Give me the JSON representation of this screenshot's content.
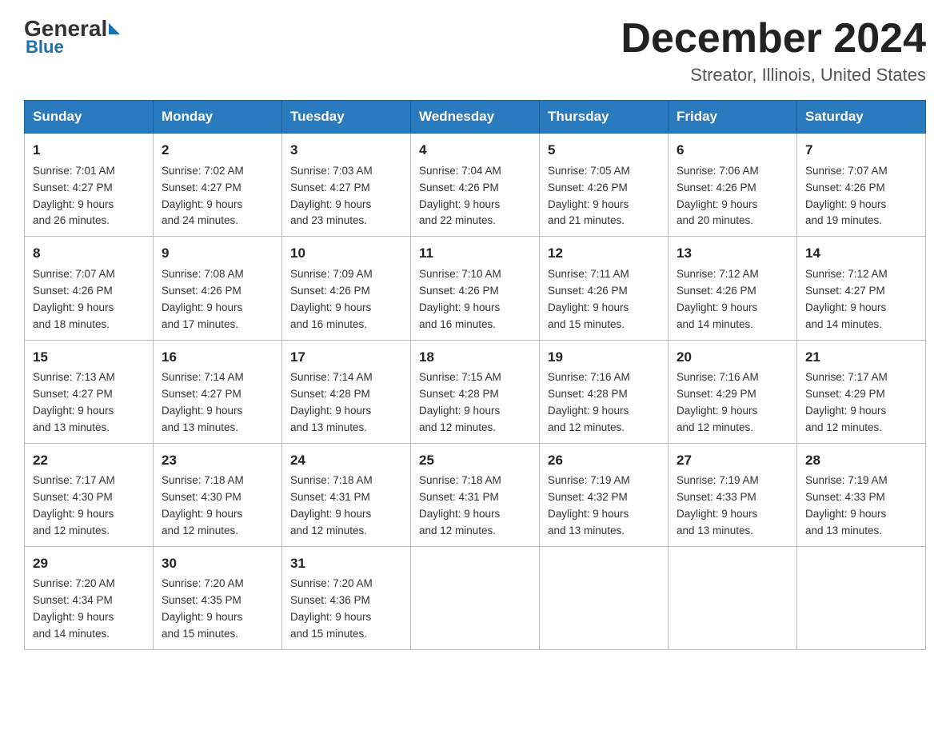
{
  "logo": {
    "general": "General",
    "blue": "Blue"
  },
  "header": {
    "month": "December 2024",
    "location": "Streator, Illinois, United States"
  },
  "weekdays": [
    "Sunday",
    "Monday",
    "Tuesday",
    "Wednesday",
    "Thursday",
    "Friday",
    "Saturday"
  ],
  "weeks": [
    [
      {
        "day": "1",
        "lines": [
          "Sunrise: 7:01 AM",
          "Sunset: 4:27 PM",
          "Daylight: 9 hours",
          "and 26 minutes."
        ]
      },
      {
        "day": "2",
        "lines": [
          "Sunrise: 7:02 AM",
          "Sunset: 4:27 PM",
          "Daylight: 9 hours",
          "and 24 minutes."
        ]
      },
      {
        "day": "3",
        "lines": [
          "Sunrise: 7:03 AM",
          "Sunset: 4:27 PM",
          "Daylight: 9 hours",
          "and 23 minutes."
        ]
      },
      {
        "day": "4",
        "lines": [
          "Sunrise: 7:04 AM",
          "Sunset: 4:26 PM",
          "Daylight: 9 hours",
          "and 22 minutes."
        ]
      },
      {
        "day": "5",
        "lines": [
          "Sunrise: 7:05 AM",
          "Sunset: 4:26 PM",
          "Daylight: 9 hours",
          "and 21 minutes."
        ]
      },
      {
        "day": "6",
        "lines": [
          "Sunrise: 7:06 AM",
          "Sunset: 4:26 PM",
          "Daylight: 9 hours",
          "and 20 minutes."
        ]
      },
      {
        "day": "7",
        "lines": [
          "Sunrise: 7:07 AM",
          "Sunset: 4:26 PM",
          "Daylight: 9 hours",
          "and 19 minutes."
        ]
      }
    ],
    [
      {
        "day": "8",
        "lines": [
          "Sunrise: 7:07 AM",
          "Sunset: 4:26 PM",
          "Daylight: 9 hours",
          "and 18 minutes."
        ]
      },
      {
        "day": "9",
        "lines": [
          "Sunrise: 7:08 AM",
          "Sunset: 4:26 PM",
          "Daylight: 9 hours",
          "and 17 minutes."
        ]
      },
      {
        "day": "10",
        "lines": [
          "Sunrise: 7:09 AM",
          "Sunset: 4:26 PM",
          "Daylight: 9 hours",
          "and 16 minutes."
        ]
      },
      {
        "day": "11",
        "lines": [
          "Sunrise: 7:10 AM",
          "Sunset: 4:26 PM",
          "Daylight: 9 hours",
          "and 16 minutes."
        ]
      },
      {
        "day": "12",
        "lines": [
          "Sunrise: 7:11 AM",
          "Sunset: 4:26 PM",
          "Daylight: 9 hours",
          "and 15 minutes."
        ]
      },
      {
        "day": "13",
        "lines": [
          "Sunrise: 7:12 AM",
          "Sunset: 4:26 PM",
          "Daylight: 9 hours",
          "and 14 minutes."
        ]
      },
      {
        "day": "14",
        "lines": [
          "Sunrise: 7:12 AM",
          "Sunset: 4:27 PM",
          "Daylight: 9 hours",
          "and 14 minutes."
        ]
      }
    ],
    [
      {
        "day": "15",
        "lines": [
          "Sunrise: 7:13 AM",
          "Sunset: 4:27 PM",
          "Daylight: 9 hours",
          "and 13 minutes."
        ]
      },
      {
        "day": "16",
        "lines": [
          "Sunrise: 7:14 AM",
          "Sunset: 4:27 PM",
          "Daylight: 9 hours",
          "and 13 minutes."
        ]
      },
      {
        "day": "17",
        "lines": [
          "Sunrise: 7:14 AM",
          "Sunset: 4:28 PM",
          "Daylight: 9 hours",
          "and 13 minutes."
        ]
      },
      {
        "day": "18",
        "lines": [
          "Sunrise: 7:15 AM",
          "Sunset: 4:28 PM",
          "Daylight: 9 hours",
          "and 12 minutes."
        ]
      },
      {
        "day": "19",
        "lines": [
          "Sunrise: 7:16 AM",
          "Sunset: 4:28 PM",
          "Daylight: 9 hours",
          "and 12 minutes."
        ]
      },
      {
        "day": "20",
        "lines": [
          "Sunrise: 7:16 AM",
          "Sunset: 4:29 PM",
          "Daylight: 9 hours",
          "and 12 minutes."
        ]
      },
      {
        "day": "21",
        "lines": [
          "Sunrise: 7:17 AM",
          "Sunset: 4:29 PM",
          "Daylight: 9 hours",
          "and 12 minutes."
        ]
      }
    ],
    [
      {
        "day": "22",
        "lines": [
          "Sunrise: 7:17 AM",
          "Sunset: 4:30 PM",
          "Daylight: 9 hours",
          "and 12 minutes."
        ]
      },
      {
        "day": "23",
        "lines": [
          "Sunrise: 7:18 AM",
          "Sunset: 4:30 PM",
          "Daylight: 9 hours",
          "and 12 minutes."
        ]
      },
      {
        "day": "24",
        "lines": [
          "Sunrise: 7:18 AM",
          "Sunset: 4:31 PM",
          "Daylight: 9 hours",
          "and 12 minutes."
        ]
      },
      {
        "day": "25",
        "lines": [
          "Sunrise: 7:18 AM",
          "Sunset: 4:31 PM",
          "Daylight: 9 hours",
          "and 12 minutes."
        ]
      },
      {
        "day": "26",
        "lines": [
          "Sunrise: 7:19 AM",
          "Sunset: 4:32 PM",
          "Daylight: 9 hours",
          "and 13 minutes."
        ]
      },
      {
        "day": "27",
        "lines": [
          "Sunrise: 7:19 AM",
          "Sunset: 4:33 PM",
          "Daylight: 9 hours",
          "and 13 minutes."
        ]
      },
      {
        "day": "28",
        "lines": [
          "Sunrise: 7:19 AM",
          "Sunset: 4:33 PM",
          "Daylight: 9 hours",
          "and 13 minutes."
        ]
      }
    ],
    [
      {
        "day": "29",
        "lines": [
          "Sunrise: 7:20 AM",
          "Sunset: 4:34 PM",
          "Daylight: 9 hours",
          "and 14 minutes."
        ]
      },
      {
        "day": "30",
        "lines": [
          "Sunrise: 7:20 AM",
          "Sunset: 4:35 PM",
          "Daylight: 9 hours",
          "and 15 minutes."
        ]
      },
      {
        "day": "31",
        "lines": [
          "Sunrise: 7:20 AM",
          "Sunset: 4:36 PM",
          "Daylight: 9 hours",
          "and 15 minutes."
        ]
      },
      null,
      null,
      null,
      null
    ]
  ]
}
